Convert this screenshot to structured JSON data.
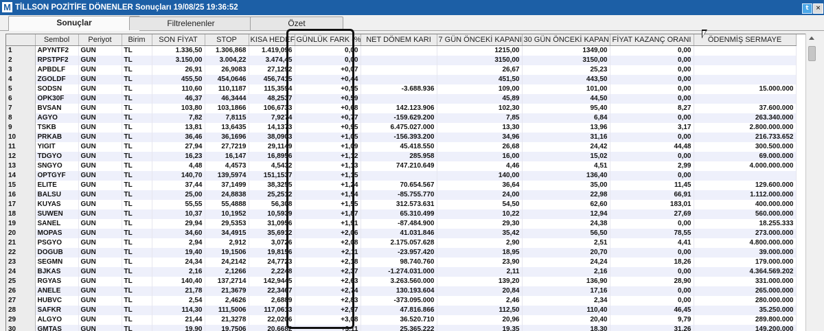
{
  "window": {
    "logo": "M",
    "title": "TİLLSON POZİTİFE DÖNENLER Sonuçları  19/08/25 19:36:52",
    "twitter_icon": "twitter-icon",
    "close_icon": "close-icon"
  },
  "tabs": [
    {
      "label": "Sonuçlar",
      "active": true
    },
    {
      "label": "Filtrelenenler",
      "active": false
    },
    {
      "label": "Özet",
      "active": false
    }
  ],
  "columns": [
    "",
    "Sembol",
    "Periyot",
    "Birim",
    "SON FİYAT",
    "STOP",
    "KISA HEDEF",
    "GÜNLÜK FARK (%)",
    "NET DÖNEM KARI",
    "7 GÜN ÖNCEKİ KAPANIŞ",
    "30 GÜN ÖNCEKİ KAPANIŞ",
    "FİYAT KAZANÇ ORANI",
    "ÖDENMİŞ SERMAYE"
  ],
  "rows": [
    [
      "1",
      "APYNTF2",
      "GUN",
      "TL",
      "1.336,50",
      "1.306,868",
      "1.419,096",
      "0,00",
      "",
      "1215,00",
      "1349,00",
      "0,00",
      ""
    ],
    [
      "2",
      "RPSTPF2",
      "GUN",
      "TL",
      "3.150,00",
      "3.004,22",
      "3.474,45",
      "0,00",
      "",
      "3150,00",
      "3150,00",
      "0,00",
      ""
    ],
    [
      "3",
      "APBDLF",
      "GUN",
      "TL",
      "26,91",
      "26,9083",
      "27,1292",
      "+0,07",
      "",
      "26,67",
      "25,23",
      "0,00",
      ""
    ],
    [
      "4",
      "ZGOLDF",
      "GUN",
      "TL",
      "455,50",
      "454,0646",
      "456,7415",
      "+0,44",
      "",
      "451,50",
      "443,50",
      "0,00",
      ""
    ],
    [
      "5",
      "SODSN",
      "GUN",
      "TL",
      "110,60",
      "110,1187",
      "115,3594",
      "+0,55",
      "-3.688.936",
      "109,00",
      "101,00",
      "0,00",
      "15.000.000"
    ],
    [
      "6",
      "OPK30F",
      "GUN",
      "TL",
      "46,37",
      "46,3444",
      "48,2537",
      "+0,59",
      "",
      "45,89",
      "44,50",
      "0,00",
      ""
    ],
    [
      "7",
      "BVSAN",
      "GUN",
      "TL",
      "103,80",
      "103,1866",
      "106,6733",
      "+0,68",
      "142.123.906",
      "102,30",
      "95,40",
      "8,27",
      "37.600.000"
    ],
    [
      "8",
      "AGYO",
      "GUN",
      "TL",
      "7,82",
      "7,8115",
      "7,9274",
      "+0,77",
      "-159.629.200",
      "7,85",
      "6,84",
      "0,00",
      "263.340.000"
    ],
    [
      "9",
      "TSKB",
      "GUN",
      "TL",
      "13,81",
      "13,6435",
      "14,1373",
      "+0,95",
      "6.475.027.000",
      "13,30",
      "13,96",
      "3,17",
      "2.800.000.000"
    ],
    [
      "10",
      "PRKAB",
      "GUN",
      "TL",
      "36,46",
      "36,1696",
      "38,0903",
      "+1,05",
      "-156.393.200",
      "34,96",
      "31,16",
      "0,00",
      "216.733.652"
    ],
    [
      "11",
      "YIGIT",
      "GUN",
      "TL",
      "27,94",
      "27,7219",
      "29,1149",
      "+1,09",
      "45.418.550",
      "26,68",
      "24,42",
      "44,48",
      "300.500.000"
    ],
    [
      "12",
      "TDGYO",
      "GUN",
      "TL",
      "16,23",
      "16,147",
      "16,8956",
      "+1,12",
      "285.958",
      "16,00",
      "15,02",
      "0,00",
      "69.000.000"
    ],
    [
      "13",
      "SNGYO",
      "GUN",
      "TL",
      "4,48",
      "4,4573",
      "4,5432",
      "+1,13",
      "747.210.649",
      "4,46",
      "4,51",
      "2,99",
      "4.000.000.000"
    ],
    [
      "14",
      "OPTGYF",
      "GUN",
      "TL",
      "140,70",
      "139,5974",
      "151,1537",
      "+1,15",
      "",
      "140,00",
      "136,40",
      "0,00",
      ""
    ],
    [
      "15",
      "ELITE",
      "GUN",
      "TL",
      "37,44",
      "37,1499",
      "38,3255",
      "+1,24",
      "70.654.567",
      "36,64",
      "35,00",
      "11,45",
      "129.600.000"
    ],
    [
      "16",
      "BALSU",
      "GUN",
      "TL",
      "25,00",
      "24,8838",
      "25,2512",
      "+1,54",
      "-85.755.770",
      "24,00",
      "22,98",
      "66,91",
      "1.112.000.000"
    ],
    [
      "17",
      "KUYAS",
      "GUN",
      "TL",
      "55,55",
      "55,4888",
      "56,308",
      "+1,55",
      "312.573.631",
      "54,50",
      "62,60",
      "183,01",
      "400.000.000"
    ],
    [
      "18",
      "SUWEN",
      "GUN",
      "TL",
      "10,37",
      "10,1952",
      "10,5939",
      "+1,87",
      "65.310.499",
      "10,22",
      "12,94",
      "27,69",
      "560.000.000"
    ],
    [
      "19",
      "SANEL",
      "GUN",
      "TL",
      "29,94",
      "29,5353",
      "31,0956",
      "+1,91",
      "-87.484.900",
      "29,30",
      "24,38",
      "0,00",
      "18.255.333"
    ],
    [
      "20",
      "MOPAS",
      "GUN",
      "TL",
      "34,60",
      "34,4915",
      "35,6912",
      "+2,06",
      "41.031.846",
      "35,42",
      "56,50",
      "78,55",
      "273.000.000"
    ],
    [
      "21",
      "PSGYO",
      "GUN",
      "TL",
      "2,94",
      "2,912",
      "3,0726",
      "+2,08",
      "2.175.057.628",
      "2,90",
      "2,51",
      "4,41",
      "4.800.000.000"
    ],
    [
      "22",
      "DOGUB",
      "GUN",
      "TL",
      "19,40",
      "19,1506",
      "19,8156",
      "+2,11",
      "-23.957.420",
      "18,95",
      "20,70",
      "0,00",
      "39.000.000"
    ],
    [
      "23",
      "SEGMN",
      "GUN",
      "TL",
      "24,34",
      "24,2142",
      "24,7723",
      "+2,18",
      "98.740.760",
      "23,90",
      "24,24",
      "18,26",
      "179.000.000"
    ],
    [
      "24",
      "BJKAS",
      "GUN",
      "TL",
      "2,16",
      "2,1266",
      "2,2248",
      "+2,37",
      "-1.274.031.000",
      "2,11",
      "2,16",
      "0,00",
      "4.364.569.202"
    ],
    [
      "25",
      "RGYAS",
      "GUN",
      "TL",
      "140,40",
      "137,2714",
      "142,9445",
      "+2,63",
      "3.263.560.000",
      "139,20",
      "136,90",
      "28,90",
      "331.000.000"
    ],
    [
      "26",
      "ANELE",
      "GUN",
      "TL",
      "21,78",
      "21,3679",
      "22,3467",
      "+2,74",
      "130.193.604",
      "20,84",
      "17,16",
      "0,00",
      "265.000.000"
    ],
    [
      "27",
      "HUBVC",
      "GUN",
      "TL",
      "2,54",
      "2,4626",
      "2,6889",
      "+2,83",
      "-373.095.000",
      "2,46",
      "2,34",
      "0,00",
      "280.000.000"
    ],
    [
      "28",
      "SAFKR",
      "GUN",
      "TL",
      "114,30",
      "111,5006",
      "117,0613",
      "+2,97",
      "47.816.866",
      "112,50",
      "110,40",
      "46,45",
      "35.250.000"
    ],
    [
      "29",
      "ALGYO",
      "GUN",
      "TL",
      "21,44",
      "21,3278",
      "22,0206",
      "+3,08",
      "36.520.710",
      "20,96",
      "20,40",
      "9,79",
      "289.800.000"
    ],
    [
      "30",
      "GMTAS",
      "GUN",
      "TL",
      "19,90",
      "19,7506",
      "20,6682",
      "+3,11",
      "25.365.222",
      "19,35",
      "18,30",
      "31,26",
      "149.200.000"
    ]
  ]
}
